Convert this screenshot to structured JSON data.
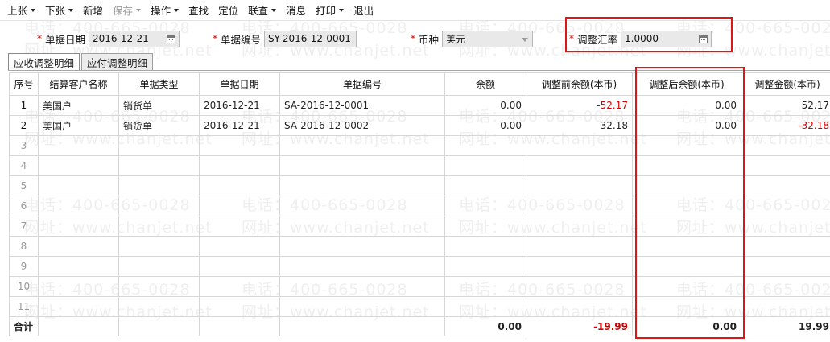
{
  "toolbar": {
    "items": [
      {
        "label": "上张",
        "dropdown": true,
        "disabled": false
      },
      {
        "label": "下张",
        "dropdown": true,
        "disabled": false
      },
      {
        "label": "新增",
        "dropdown": false,
        "disabled": false
      },
      {
        "label": "保存",
        "dropdown": true,
        "disabled": true
      },
      {
        "label": "操作",
        "dropdown": true,
        "disabled": false
      },
      {
        "label": "查找",
        "dropdown": false,
        "disabled": false
      },
      {
        "label": "定位",
        "dropdown": false,
        "disabled": false
      },
      {
        "label": "联查",
        "dropdown": true,
        "disabled": false
      },
      {
        "label": "消息",
        "dropdown": false,
        "disabled": false
      },
      {
        "label": "打印",
        "dropdown": true,
        "disabled": false
      },
      {
        "label": "退出",
        "dropdown": false,
        "disabled": false
      }
    ]
  },
  "form": {
    "doc_date": {
      "label": "单据日期",
      "value": "2016-12-21"
    },
    "doc_no": {
      "label": "单据编号",
      "value": "SY-2016-12-0001"
    },
    "currency": {
      "label": "币种",
      "value": "美元"
    },
    "rate": {
      "label": "调整汇率",
      "value": "1.0000"
    }
  },
  "tabs": [
    {
      "label": "应收调整明细",
      "active": true
    },
    {
      "label": "应付调整明细",
      "active": false
    }
  ],
  "table": {
    "headers": [
      "序号",
      "结算客户名称",
      "单据类型",
      "单据日期",
      "单据编号",
      "余额",
      "调整前余额(本币)",
      "调整后余额(本币)",
      "调整金额(本币)"
    ],
    "rows": [
      {
        "seq": "1",
        "customer": "美国户",
        "type": "销货单",
        "date": "2016-12-21",
        "no": "SA-2016-12-0001",
        "balance": "0.00",
        "before": "-52.17",
        "after": "0.00",
        "adjust": "52.17"
      },
      {
        "seq": "2",
        "customer": "美国户",
        "type": "销货单",
        "date": "2016-12-21",
        "no": "SA-2016-12-0002",
        "balance": "0.00",
        "before": "32.18",
        "after": "0.00",
        "adjust": "-32.18"
      },
      {
        "seq": "3"
      },
      {
        "seq": "4"
      },
      {
        "seq": "5"
      },
      {
        "seq": "6"
      },
      {
        "seq": "7"
      },
      {
        "seq": "8"
      },
      {
        "seq": "9"
      },
      {
        "seq": "10"
      },
      {
        "seq": "11"
      }
    ],
    "total": {
      "label": "合计",
      "balance": "0.00",
      "before": "-19.99",
      "after": "0.00",
      "adjust": "19.99"
    }
  },
  "watermark": {
    "phone": "电话：400-665-0028",
    "site": "网址：www.chanjet.net"
  },
  "colors": {
    "negative": "#d00000",
    "highlight": "#e01515",
    "required": "#d00000"
  }
}
